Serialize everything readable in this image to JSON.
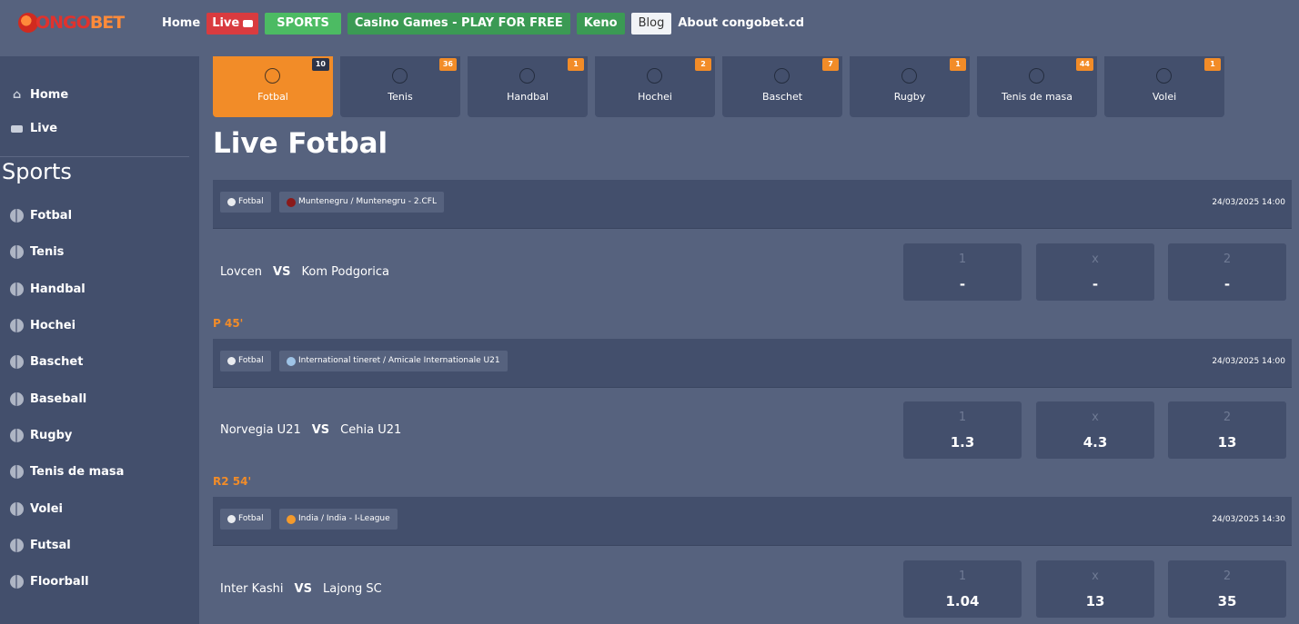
{
  "brand": {
    "logo_text_1": "ONGO",
    "logo_text_2": "BET"
  },
  "nav": {
    "home": "Home",
    "live": "Live",
    "sports": "SPORTS",
    "casino": "Casino Games - PLAY FOR FREE",
    "keno": "Keno",
    "blog": "Blog",
    "about": "About congobet.cd"
  },
  "sidebar": {
    "home": "Home",
    "live": "Live",
    "heading": "Sports",
    "items": [
      {
        "label": "Fotbal",
        "icon": "football-icon"
      },
      {
        "label": "Tenis",
        "icon": "tennis-icon"
      },
      {
        "label": "Handbal",
        "icon": "handball-icon"
      },
      {
        "label": "Hochei",
        "icon": "hockey-icon"
      },
      {
        "label": "Baschet",
        "icon": "basketball-icon"
      },
      {
        "label": "Baseball",
        "icon": "baseball-icon"
      },
      {
        "label": "Rugby",
        "icon": "rugby-icon"
      },
      {
        "label": "Tenis de masa",
        "icon": "table-tennis-icon"
      },
      {
        "label": "Volei",
        "icon": "volleyball-icon"
      },
      {
        "label": "Futsal",
        "icon": "futsal-icon"
      },
      {
        "label": "Floorball",
        "icon": "floorball-icon"
      }
    ]
  },
  "tabs": [
    {
      "label": "Fotbal",
      "count": "10",
      "active": true
    },
    {
      "label": "Tenis",
      "count": "36"
    },
    {
      "label": "Handbal",
      "count": "1"
    },
    {
      "label": "Hochei",
      "count": "2"
    },
    {
      "label": "Baschet",
      "count": "7"
    },
    {
      "label": "Rugby",
      "count": "1"
    },
    {
      "label": "Tenis de masa",
      "count": "44"
    },
    {
      "label": "Volei",
      "count": "1"
    }
  ],
  "page_title": "Live Fotbal",
  "matches": [
    {
      "sport": "Fotbal",
      "league": "Muntenegru / Muntenegru - 2.CFL",
      "date": "24/03/2025 14:00",
      "home": "Lovcen",
      "vs": "VS",
      "away": "Kom Podgorica",
      "odds": [
        {
          "label": "1",
          "value": "-"
        },
        {
          "label": "x",
          "value": "-"
        },
        {
          "label": "2",
          "value": "-"
        }
      ],
      "status": "P 45'"
    },
    {
      "sport": "Fotbal",
      "league": "International tineret / Amicale Internationale U21",
      "date": "24/03/2025 14:00",
      "home": "Norvegia U21",
      "vs": "VS",
      "away": "Cehia U21",
      "odds": [
        {
          "label": "1",
          "value": "1.3"
        },
        {
          "label": "x",
          "value": "4.3"
        },
        {
          "label": "2",
          "value": "13"
        }
      ],
      "status": "R2 54'"
    },
    {
      "sport": "Fotbal",
      "league": "India / India - I-League",
      "date": "24/03/2025 14:30",
      "home": "Inter Kashi",
      "vs": "VS",
      "away": "Lajong SC",
      "odds": [
        {
          "label": "1",
          "value": "1.04"
        },
        {
          "label": "x",
          "value": "13"
        },
        {
          "label": "2",
          "value": "35"
        }
      ]
    }
  ]
}
